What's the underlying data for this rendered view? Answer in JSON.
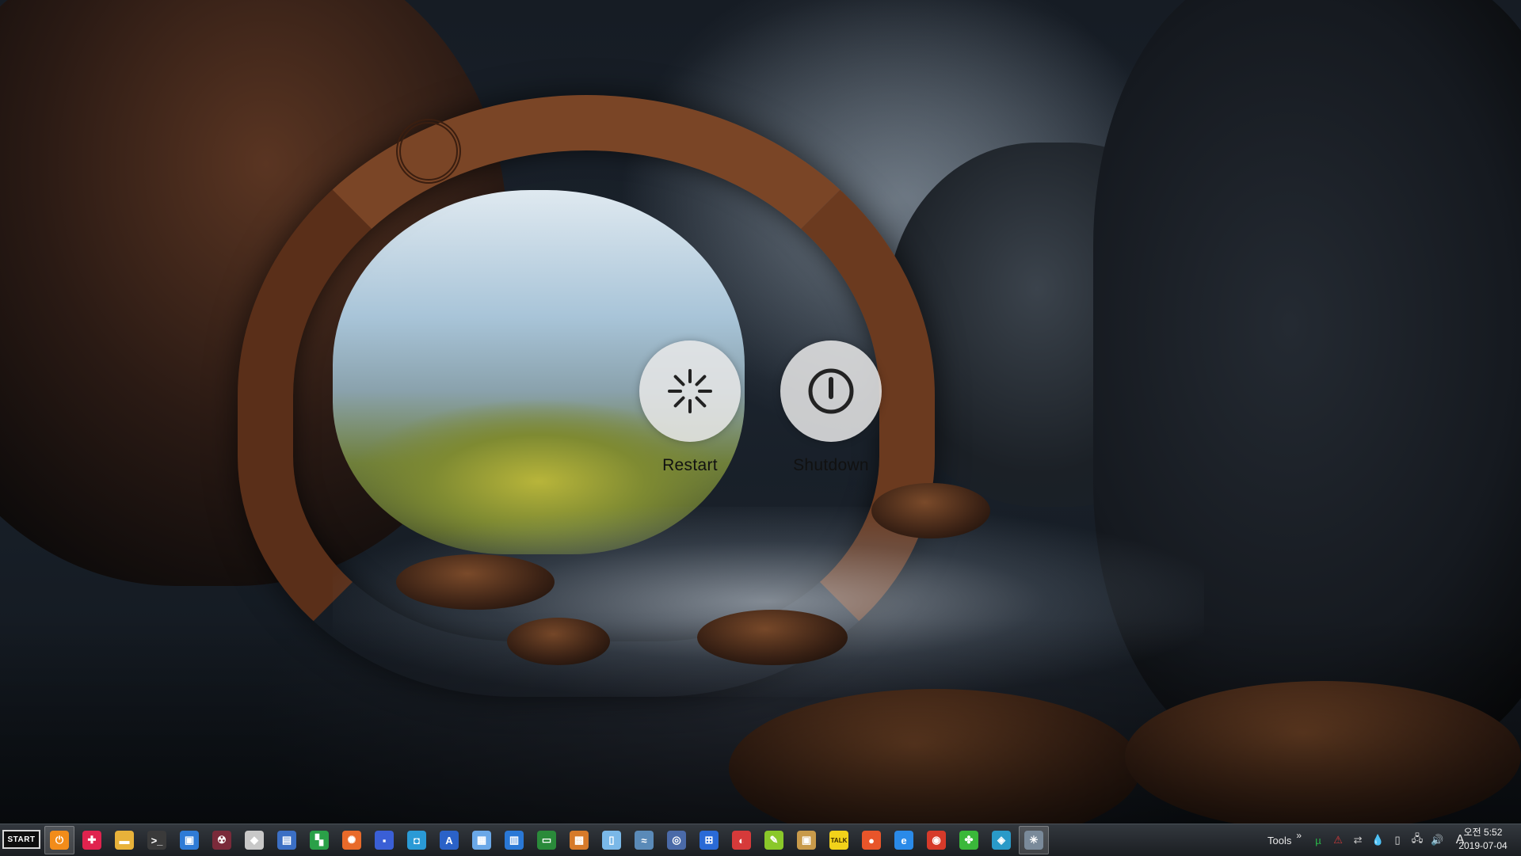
{
  "overlay": {
    "restart_label": "Restart",
    "shutdown_label": "Shutdown"
  },
  "taskbar": {
    "start_label": "START",
    "pinned": [
      {
        "name": "power-app-icon",
        "glyph": "⏻",
        "color": "#f28c1a",
        "active": true
      },
      {
        "name": "red-app-icon",
        "glyph": "✚",
        "color": "#e0234e"
      },
      {
        "name": "file-explorer-icon",
        "glyph": "▬",
        "color": "#e8b23a"
      },
      {
        "name": "command-prompt-icon",
        "glyph": ">_",
        "color": "#3a3a3a"
      },
      {
        "name": "remote-desktop-icon",
        "glyph": "▣",
        "color": "#2f7bd6"
      },
      {
        "name": "radiation-app-icon",
        "glyph": "☢",
        "color": "#7a2a3a"
      },
      {
        "name": "diamond-app-icon",
        "glyph": "◆",
        "color": "#c8c8c8"
      },
      {
        "name": "computer-icon",
        "glyph": "▤",
        "color": "#3b6fc4"
      },
      {
        "name": "chart-app-icon",
        "glyph": "▚",
        "color": "#2aa048"
      },
      {
        "name": "settings-app-icon",
        "glyph": "✺",
        "color": "#e86a2a"
      },
      {
        "name": "save-disk-icon",
        "glyph": "▪",
        "color": "#3a5fd6"
      },
      {
        "name": "cube-app-icon",
        "glyph": "◘",
        "color": "#2a9ad6"
      },
      {
        "name": "text-editor-icon",
        "glyph": "A",
        "color": "#2b62c8"
      },
      {
        "name": "document-app-icon",
        "glyph": "▦",
        "color": "#6aa8e8"
      },
      {
        "name": "notes-app-icon",
        "glyph": "▥",
        "color": "#2a78d6"
      },
      {
        "name": "terminal-app-icon",
        "glyph": "▭",
        "color": "#2a8a3a"
      },
      {
        "name": "windows-tiles-icon",
        "glyph": "▩",
        "color": "#d67a2a"
      },
      {
        "name": "recycle-bin-icon",
        "glyph": "▯",
        "color": "#7ab8e8"
      },
      {
        "name": "fish-app-icon",
        "glyph": "≈",
        "color": "#5a8ab8"
      },
      {
        "name": "network-app-icon",
        "glyph": "◎",
        "color": "#4a6aa8"
      },
      {
        "name": "windows-logo-icon",
        "glyph": "⊞",
        "color": "#2a6ad6"
      },
      {
        "name": "color-app-icon",
        "glyph": "◐",
        "color": "#d63a3a"
      },
      {
        "name": "paint-app-icon",
        "glyph": "✎",
        "color": "#8ac82a"
      },
      {
        "name": "archive-app-icon",
        "glyph": "▣",
        "color": "#c89a4a"
      },
      {
        "name": "kakaotalk-icon",
        "glyph": "TALK",
        "color": "#f2d21a"
      },
      {
        "name": "firefox-icon",
        "glyph": "●",
        "color": "#e8552a"
      },
      {
        "name": "internet-explorer-icon",
        "glyph": "e",
        "color": "#2a8ae8"
      },
      {
        "name": "chrome-icon",
        "glyph": "◉",
        "color": "#d63a2a"
      },
      {
        "name": "clover-app-icon",
        "glyph": "✤",
        "color": "#3ab83a"
      },
      {
        "name": "layers-app-icon",
        "glyph": "◈",
        "color": "#2a9ac8"
      },
      {
        "name": "shutdown-app-icon",
        "glyph": "✳",
        "color": "#7a8a9a",
        "active": true
      }
    ]
  },
  "tray": {
    "tools_label": "Tools",
    "chevron": "»",
    "icons": [
      {
        "name": "utorrent-icon",
        "glyph": "µ",
        "color": "#2ab84a"
      },
      {
        "name": "antivirus-icon",
        "glyph": "⚠",
        "color": "#d63a3a"
      },
      {
        "name": "network-share-icon",
        "glyph": "⇄",
        "color": "#c8c8c8"
      },
      {
        "name": "water-drop-icon",
        "glyph": "💧",
        "color": "#e0e0e0"
      },
      {
        "name": "usb-device-icon",
        "glyph": "▯",
        "color": "#e0e0e0"
      },
      {
        "name": "network-icon",
        "glyph": "🖧",
        "color": "#e0e0e0"
      },
      {
        "name": "volume-icon",
        "glyph": "🔊",
        "color": "#e0e0e0"
      }
    ],
    "ime_label": "A"
  },
  "clock": {
    "time": "오전 5:52",
    "date": "2019-07-04"
  }
}
